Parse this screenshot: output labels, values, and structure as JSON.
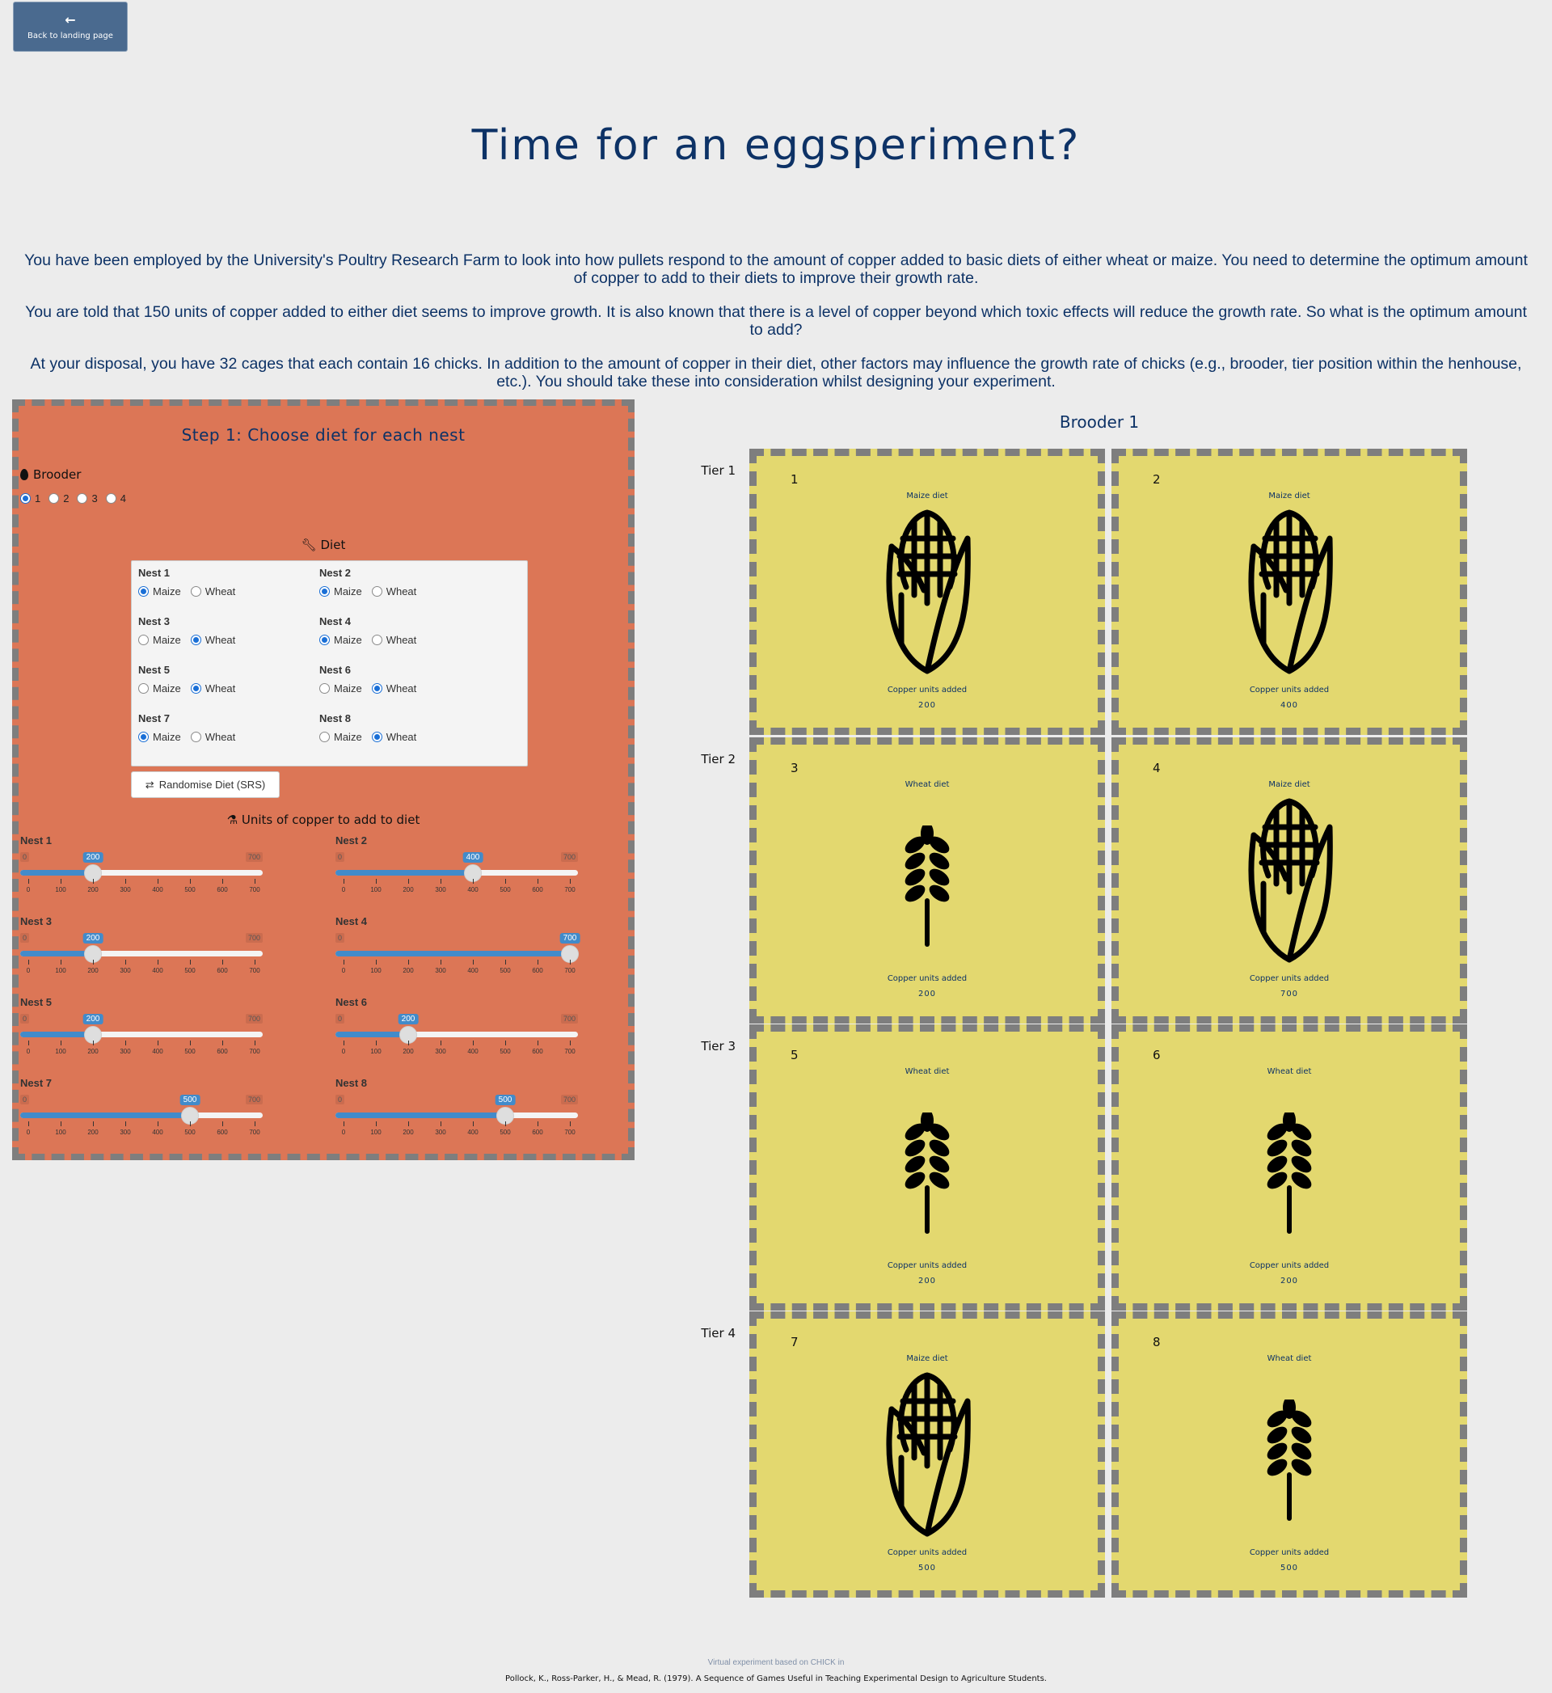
{
  "back_button": {
    "icon": "arrow-left-icon",
    "label": "Back to landing page"
  },
  "title": "Time for an eggsperiment?",
  "intro": [
    "You have been employed by the University's Poultry Research Farm to look into how pullets respond to the amount of copper added to basic diets of either wheat or maize. You need to determine the optimum amount of copper to add to their diets to improve their growth rate.",
    "You are told that 150 units of copper added to either diet seems to improve growth. It is also known that there is a level of copper beyond which toxic effects will reduce the growth rate. So what is the optimum amount to add?",
    "At your disposal, you have 32 cages that each contain 16 chicks. In addition to the amount of copper in their diet, other factors may influence the growth rate of chicks (e.g., brooder, tier position within the henhouse, etc.). You should take these into consideration whilst designing your experiment."
  ],
  "step1": {
    "title": "Step 1: Choose diet for each nest",
    "brooder_label": "Brooder",
    "brooder_options": [
      "1",
      "2",
      "3",
      "4"
    ],
    "brooder_selected": "1",
    "diet_heading": "Diet",
    "diet_options": [
      "Maize",
      "Wheat"
    ],
    "nests": [
      {
        "name": "Nest 1",
        "diet": "Maize"
      },
      {
        "name": "Nest 2",
        "diet": "Maize"
      },
      {
        "name": "Nest 3",
        "diet": "Wheat"
      },
      {
        "name": "Nest 4",
        "diet": "Maize"
      },
      {
        "name": "Nest 5",
        "diet": "Wheat"
      },
      {
        "name": "Nest 6",
        "diet": "Wheat"
      },
      {
        "name": "Nest 7",
        "diet": "Maize"
      },
      {
        "name": "Nest 8",
        "diet": "Wheat"
      }
    ],
    "randomise_label": "Randomise Diet (SRS)",
    "copper_heading": "Units of copper to add to diet",
    "slider_min": 0,
    "slider_max": 700,
    "slider_ticks": [
      "0",
      "100",
      "200",
      "300",
      "400",
      "500",
      "600",
      "700"
    ],
    "copper": [
      {
        "name": "Nest 1",
        "value": 200
      },
      {
        "name": "Nest 2",
        "value": 400
      },
      {
        "name": "Nest 3",
        "value": 200
      },
      {
        "name": "Nest 4",
        "value": 700
      },
      {
        "name": "Nest 5",
        "value": 200
      },
      {
        "name": "Nest 6",
        "value": 200
      },
      {
        "name": "Nest 7",
        "value": 500
      },
      {
        "name": "Nest 8",
        "value": 500
      }
    ]
  },
  "brooder_view": {
    "title": "Brooder 1",
    "tiers": [
      "Tier 1",
      "Tier 2",
      "Tier 3",
      "Tier 4"
    ],
    "copper_label": "Copper units added",
    "cages": [
      {
        "num": "1",
        "diet_label": "Maize diet",
        "icon": "corn-icon",
        "copper": "200"
      },
      {
        "num": "2",
        "diet_label": "Maize diet",
        "icon": "corn-icon",
        "copper": "400"
      },
      {
        "num": "3",
        "diet_label": "Wheat diet",
        "icon": "wheat-icon",
        "copper": "200"
      },
      {
        "num": "4",
        "diet_label": "Maize diet",
        "icon": "corn-icon",
        "copper": "700"
      },
      {
        "num": "5",
        "diet_label": "Wheat diet",
        "icon": "wheat-icon",
        "copper": "200"
      },
      {
        "num": "6",
        "diet_label": "Wheat diet",
        "icon": "wheat-icon",
        "copper": "200"
      },
      {
        "num": "7",
        "diet_label": "Maize diet",
        "icon": "corn-icon",
        "copper": "500"
      },
      {
        "num": "8",
        "diet_label": "Wheat diet",
        "icon": "wheat-icon",
        "copper": "500"
      }
    ]
  },
  "footer": {
    "line1": "Virtual experiment based on CHICK in",
    "line2": "Pollock, K., Ross-Parker, H., & Mead, R. (1979). A Sequence of Games Useful in Teaching Experimental Design to Agriculture Students."
  },
  "colors": {
    "panel_bg": "#dc7656",
    "cage_bg": "#e3d86f",
    "accent": "#428bca",
    "title": "#0d3266"
  }
}
